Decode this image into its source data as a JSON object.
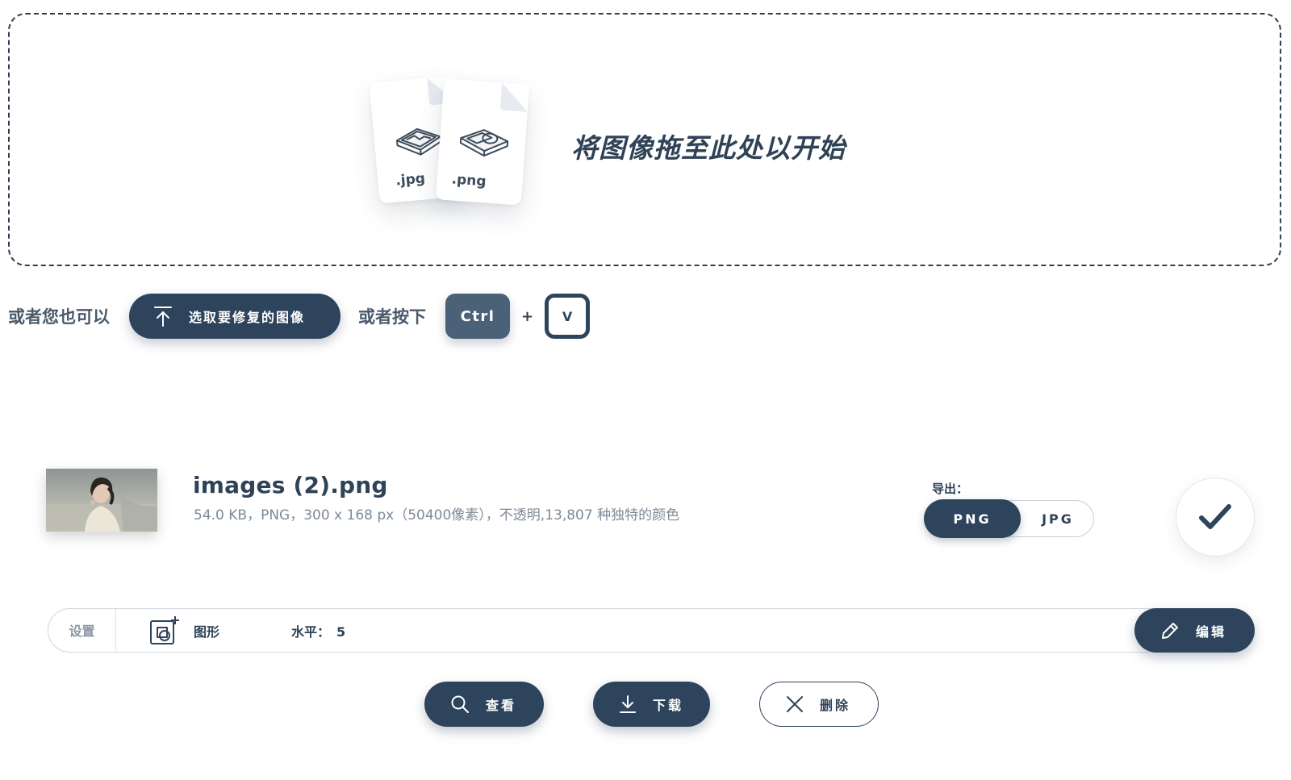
{
  "dropzone": {
    "title": "将图像拖至此处以开始",
    "cards": [
      {
        "ext": ".jpg",
        "icon": "image-icon"
      },
      {
        "ext": ".png",
        "icon": "shape-image-icon"
      }
    ]
  },
  "alt": {
    "or_you_can": "或者您也可以",
    "upload_label": "选取要修复的图像",
    "or_press": "或者按下",
    "key_ctrl": "Ctrl",
    "plus": "+",
    "key_v": "V"
  },
  "file": {
    "name": "images (2).png",
    "meta": "54.0 KB，PNG，300 x 168 px（50400像素），不透明,13,807 种独特的颜色",
    "export_label": "导出：",
    "formats": [
      "PNG",
      "JPG"
    ],
    "selected_format": "PNG"
  },
  "settings": {
    "label": "设置",
    "shape_label": "图形",
    "level_label": "水平：",
    "level_value": "5",
    "edit_label": "编辑"
  },
  "actions": {
    "view": "查看",
    "download": "下载",
    "delete": "删除"
  },
  "colors": {
    "primary": "#2e445c",
    "key_ctrl": "#4a6178",
    "text_muted": "#7d8a97",
    "border": "#cfd6dd"
  }
}
